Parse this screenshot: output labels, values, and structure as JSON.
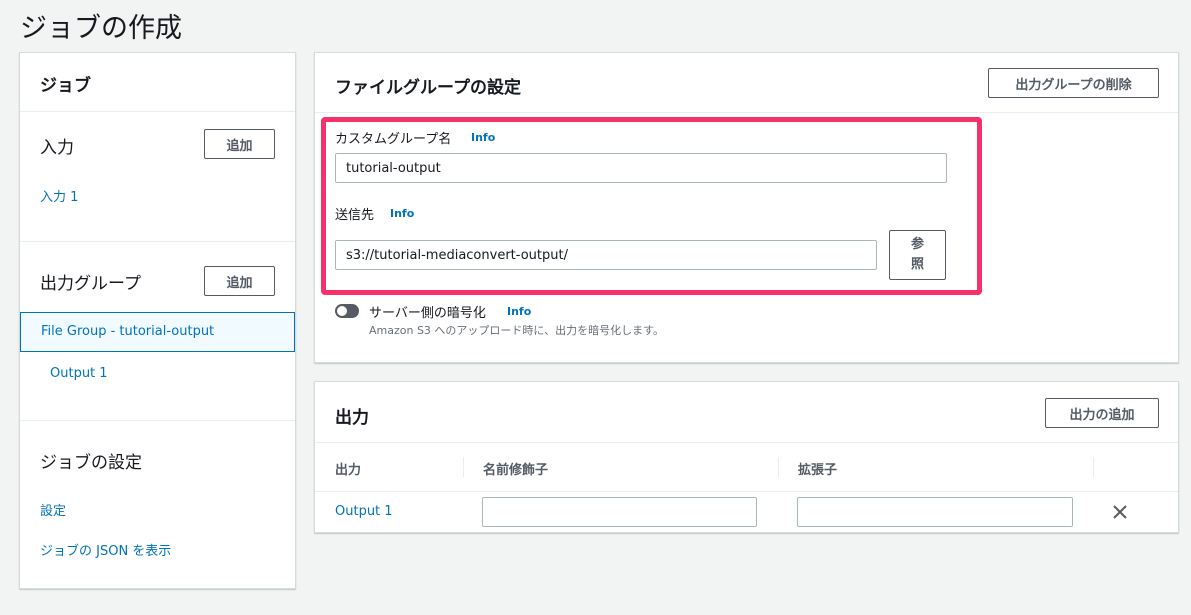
{
  "page": {
    "title": "ジョブの作成"
  },
  "sidebar": {
    "header": "ジョブ",
    "input_section": {
      "title": "入力",
      "add_label": "追加",
      "items": [
        "入力 1"
      ]
    },
    "output_section": {
      "title": "出力グループ",
      "add_label": "追加",
      "selected_group": "File Group - tutorial-output",
      "items": [
        "Output 1"
      ]
    },
    "settings_section": {
      "title": "ジョブの設定",
      "links": [
        "設定",
        "ジョブの JSON を表示"
      ]
    }
  },
  "file_group": {
    "title": "ファイルグループの設定",
    "delete_label": "出力グループの削除",
    "custom_name": {
      "label": "カスタムグループ名",
      "info": "Info",
      "value": "tutorial-output"
    },
    "destination": {
      "label": "送信先",
      "info": "Info",
      "value": "s3://tutorial-mediaconvert-output/",
      "browse_label_line1": "参",
      "browse_label_line2": "照"
    },
    "encryption": {
      "label": "サーバー側の暗号化",
      "info": "Info",
      "description": "Amazon S3 へのアップロード時に、出力を暗号化します。",
      "enabled": false
    }
  },
  "outputs": {
    "title": "出力",
    "add_label": "出力の追加",
    "columns": [
      "出力",
      "名前修飾子",
      "拡張子"
    ],
    "rows": [
      {
        "name": "Output 1",
        "name_modifier": "",
        "extension": ""
      }
    ]
  },
  "colors": {
    "highlight": "#f73169",
    "link": "#0073bb",
    "background": "#f2f3f3"
  },
  "icons": {
    "row_remove": "close-icon"
  }
}
